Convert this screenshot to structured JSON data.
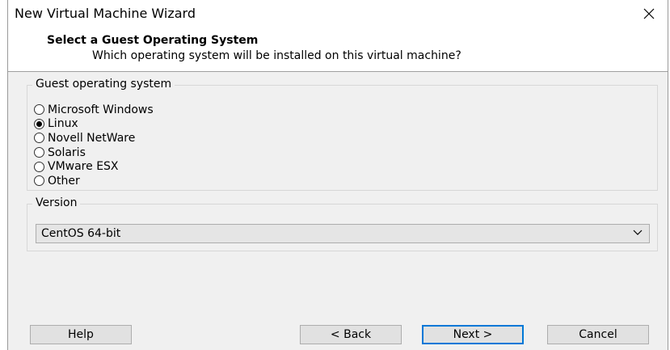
{
  "window": {
    "title": "New Virtual Machine Wizard",
    "close_icon": "close-icon"
  },
  "header": {
    "title": "Select a Guest Operating System",
    "subtitle": "Which operating system will be installed on this virtual machine?"
  },
  "guest_os": {
    "legend": "Guest operating system",
    "options": [
      {
        "label": "Microsoft Windows",
        "checked": false
      },
      {
        "label": "Linux",
        "checked": true
      },
      {
        "label": "Novell NetWare",
        "checked": false
      },
      {
        "label": "Solaris",
        "checked": false
      },
      {
        "label": "VMware ESX",
        "checked": false
      },
      {
        "label": "Other",
        "checked": false
      }
    ]
  },
  "version": {
    "legend": "Version",
    "selected": "CentOS 64-bit",
    "chevron_icon": "chevron-down-icon"
  },
  "buttons": {
    "help": "Help",
    "back": "< Back",
    "next": "Next >",
    "cancel": "Cancel"
  },
  "colors": {
    "accent": "#0078d7",
    "dialog_bg": "#f0f0f0",
    "header_bg": "#ffffff"
  }
}
